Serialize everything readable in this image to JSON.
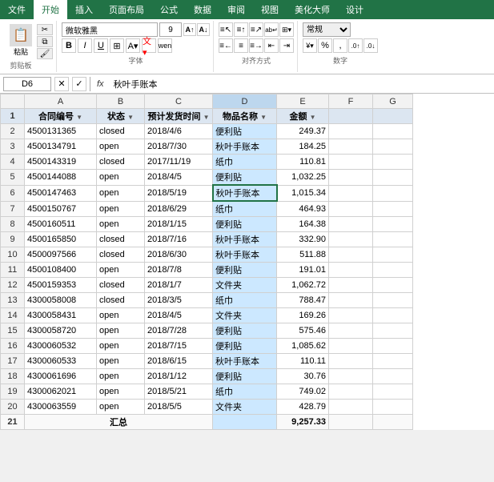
{
  "ribbon": {
    "tabs": [
      "文件",
      "开始",
      "插入",
      "页面布局",
      "公式",
      "数据",
      "审阅",
      "视图",
      "美化大师",
      "设计"
    ],
    "active_tab": "开始",
    "font_name": "微软雅黑",
    "font_size": "9",
    "style_box": "常规",
    "groups": [
      "剪贴板",
      "字体",
      "对齐方式",
      "数字"
    ]
  },
  "formula_bar": {
    "cell_ref": "D6",
    "formula": "秋叶手账本"
  },
  "columns": [
    {
      "label": "A",
      "header": "合同编号"
    },
    {
      "label": "B",
      "header": "状态"
    },
    {
      "label": "C",
      "header": "预计发货时间"
    },
    {
      "label": "D",
      "header": "物品名称"
    },
    {
      "label": "E",
      "header": "金额"
    },
    {
      "label": "F",
      "header": ""
    },
    {
      "label": "G",
      "header": ""
    }
  ],
  "rows": [
    {
      "num": 2,
      "a": "4500131365",
      "b": "closed",
      "c": "2018/4/6",
      "d": "便利贴",
      "e": "249.37"
    },
    {
      "num": 3,
      "a": "4500134791",
      "b": "open",
      "c": "2018/7/30",
      "d": "秋叶手账本",
      "e": "184.25"
    },
    {
      "num": 4,
      "a": "4500143319",
      "b": "closed",
      "c": "2017/11/19",
      "d": "纸巾",
      "e": "110.81"
    },
    {
      "num": 5,
      "a": "4500144088",
      "b": "open",
      "c": "2018/4/5",
      "d": "便利贴",
      "e": "1,032.25"
    },
    {
      "num": 6,
      "a": "4500147463",
      "b": "open",
      "c": "2018/5/19",
      "d": "秋叶手账本",
      "e": "1,015.34",
      "selected": true
    },
    {
      "num": 7,
      "a": "4500150767",
      "b": "open",
      "c": "2018/6/29",
      "d": "纸巾",
      "e": "464.93"
    },
    {
      "num": 8,
      "a": "4500160511",
      "b": "open",
      "c": "2018/1/15",
      "d": "便利贴",
      "e": "164.38"
    },
    {
      "num": 9,
      "a": "4500165850",
      "b": "closed",
      "c": "2018/7/16",
      "d": "秋叶手账本",
      "e": "332.90"
    },
    {
      "num": 10,
      "a": "4500097566",
      "b": "closed",
      "c": "2018/6/30",
      "d": "秋叶手账本",
      "e": "511.88"
    },
    {
      "num": 11,
      "a": "4500108400",
      "b": "open",
      "c": "2018/7/8",
      "d": "便利贴",
      "e": "191.01"
    },
    {
      "num": 12,
      "a": "4500159353",
      "b": "closed",
      "c": "2018/1/7",
      "d": "文件夹",
      "e": "1,062.72"
    },
    {
      "num": 13,
      "a": "4300058008",
      "b": "closed",
      "c": "2018/3/5",
      "d": "纸巾",
      "e": "788.47"
    },
    {
      "num": 14,
      "a": "4300058431",
      "b": "open",
      "c": "2018/4/5",
      "d": "文件夹",
      "e": "169.26"
    },
    {
      "num": 15,
      "a": "4300058720",
      "b": "open",
      "c": "2018/7/28",
      "d": "便利贴",
      "e": "575.46"
    },
    {
      "num": 16,
      "a": "4300060532",
      "b": "open",
      "c": "2018/7/15",
      "d": "便利贴",
      "e": "1,085.62"
    },
    {
      "num": 17,
      "a": "4300060533",
      "b": "open",
      "c": "2018/6/15",
      "d": "秋叶手账本",
      "e": "110.11"
    },
    {
      "num": 18,
      "a": "4300061696",
      "b": "open",
      "c": "2018/1/12",
      "d": "便利贴",
      "e": "30.76"
    },
    {
      "num": 19,
      "a": "4300062021",
      "b": "open",
      "c": "2018/5/21",
      "d": "纸巾",
      "e": "749.02"
    },
    {
      "num": 20,
      "a": "4300063559",
      "b": "open",
      "c": "2018/5/5",
      "d": "文件夹",
      "e": "428.79"
    }
  ],
  "total_row": {
    "num": 21,
    "label": "汇总",
    "value": "9,257.33"
  }
}
